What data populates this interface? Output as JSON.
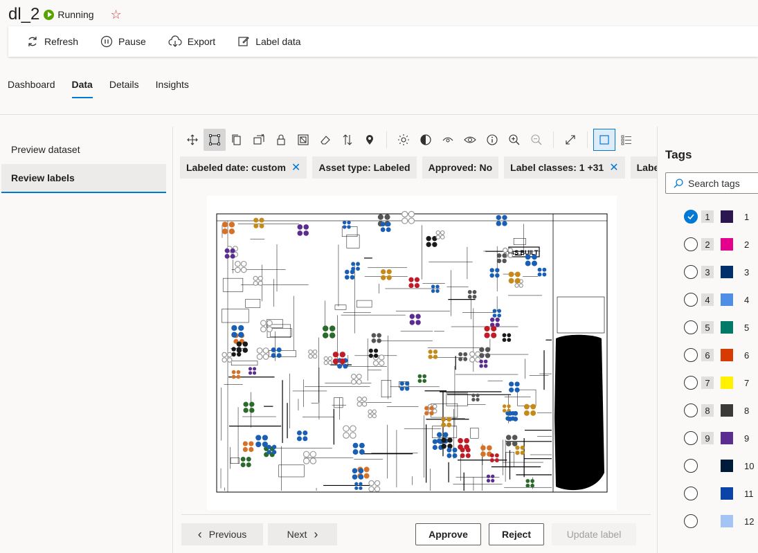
{
  "header": {
    "run_name": "dl_2",
    "status": "Running"
  },
  "toolbar": {
    "refresh": "Refresh",
    "pause": "Pause",
    "export": "Export",
    "label_data": "Label data"
  },
  "tabs": [
    {
      "label": "Dashboard"
    },
    {
      "label": "Data",
      "active": true
    },
    {
      "label": "Details"
    },
    {
      "label": "Insights"
    }
  ],
  "sidebar": {
    "items": [
      {
        "label": "Preview dataset"
      },
      {
        "label": "Review labels",
        "active": true
      }
    ]
  },
  "filters": [
    {
      "label": "Labeled date: custom",
      "removable": true
    },
    {
      "label": "Asset type: Labeled",
      "removable": false
    },
    {
      "label": "Approved: No",
      "removable": false
    },
    {
      "label": "Label classes: 1 +31",
      "removable": true
    },
    {
      "label": "Labelers: Osc",
      "removable": false
    }
  ],
  "image_annotations": {
    "as_built": "AS BUILT"
  },
  "actions": {
    "previous": "Previous",
    "next": "Next",
    "approve": "Approve",
    "reject": "Reject",
    "update_label": "Update label"
  },
  "tags_panel": {
    "title": "Tags",
    "search_placeholder": "Search tags",
    "tags": [
      {
        "key": "1",
        "name": "1",
        "color": "#2b1650",
        "checked": true
      },
      {
        "key": "2",
        "name": "2",
        "color": "#e3008c",
        "checked": false
      },
      {
        "key": "3",
        "name": "3",
        "color": "#00306b",
        "checked": false
      },
      {
        "key": "4",
        "name": "4",
        "color": "#4f8ee6",
        "checked": false
      },
      {
        "key": "5",
        "name": "5",
        "color": "#007a68",
        "checked": false
      },
      {
        "key": "6",
        "name": "6",
        "color": "#d83b01",
        "checked": false
      },
      {
        "key": "7",
        "name": "7",
        "color": "#fff100",
        "checked": false
      },
      {
        "key": "8",
        "name": "8",
        "color": "#3b3a39",
        "checked": false
      },
      {
        "key": "9",
        "name": "9",
        "color": "#5c2d91",
        "checked": false
      },
      {
        "key": "",
        "name": "10",
        "color": "#001a3a",
        "checked": false
      },
      {
        "key": "",
        "name": "11",
        "color": "#0a44a8",
        "checked": false
      },
      {
        "key": "",
        "name": "12",
        "color": "#a4c4f4",
        "checked": false
      }
    ]
  }
}
